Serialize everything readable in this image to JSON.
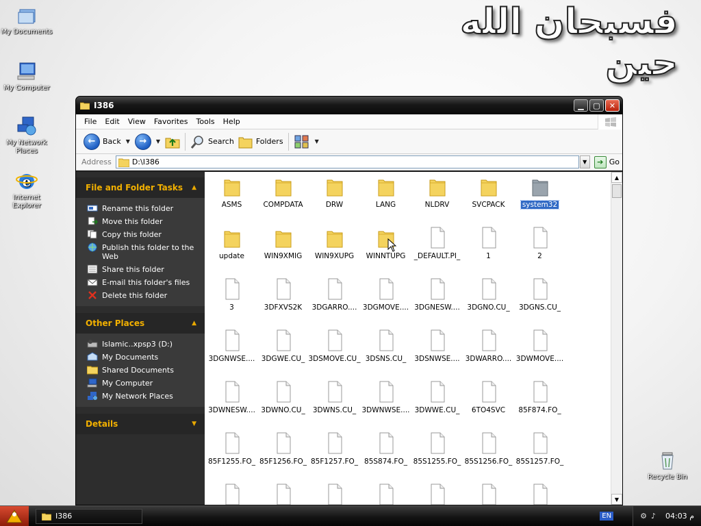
{
  "desktop": {
    "banner_text": "فسبحان الله حين",
    "icons": [
      {
        "label": "My Documents"
      },
      {
        "label": "My Computer"
      },
      {
        "label": "My Network Places"
      },
      {
        "label": "Internet Explorer"
      },
      {
        "label": "Recycle Bin"
      }
    ]
  },
  "window": {
    "title": "I386",
    "menu": [
      "File",
      "Edit",
      "View",
      "Favorites",
      "Tools",
      "Help"
    ],
    "toolbar": {
      "back": "Back",
      "search": "Search",
      "folders": "Folders"
    },
    "address": {
      "label": "Address",
      "value": "D:\\I386",
      "go": "Go"
    }
  },
  "taskpane": {
    "file_folder_tasks": {
      "title": "File and Folder Tasks",
      "items": [
        "Rename this folder",
        "Move this folder",
        "Copy this folder",
        "Publish this folder to the Web",
        "Share this folder",
        "E-mail this folder's files",
        "Delete this folder"
      ]
    },
    "other_places": {
      "title": "Other Places",
      "items": [
        "Islamic..xpsp3 (D:)",
        "My Documents",
        "Shared Documents",
        "My Computer",
        "My Network Places"
      ]
    },
    "details": {
      "title": "Details"
    }
  },
  "files": [
    {
      "name": "ASMS",
      "type": "folder"
    },
    {
      "name": "COMPDATA",
      "type": "folder"
    },
    {
      "name": "DRW",
      "type": "folder"
    },
    {
      "name": "LANG",
      "type": "folder"
    },
    {
      "name": "NLDRV",
      "type": "folder"
    },
    {
      "name": "SVCPACK",
      "type": "folder"
    },
    {
      "name": "system32",
      "type": "folder-gray",
      "selected": true
    },
    {
      "name": "update",
      "type": "folder"
    },
    {
      "name": "WIN9XMIG",
      "type": "folder"
    },
    {
      "name": "WIN9XUPG",
      "type": "folder"
    },
    {
      "name": "WINNTUPG",
      "type": "folder"
    },
    {
      "name": "_DEFAULT.PI_",
      "type": "file"
    },
    {
      "name": "1",
      "type": "file"
    },
    {
      "name": "2",
      "type": "file"
    },
    {
      "name": "3",
      "type": "file"
    },
    {
      "name": "3DFXVS2K",
      "type": "file"
    },
    {
      "name": "3DGARRO....",
      "type": "file"
    },
    {
      "name": "3DGMOVE....",
      "type": "file"
    },
    {
      "name": "3DGNESW....",
      "type": "file"
    },
    {
      "name": "3DGNO.CU_",
      "type": "file"
    },
    {
      "name": "3DGNS.CU_",
      "type": "file"
    },
    {
      "name": "3DGNWSE....",
      "type": "file"
    },
    {
      "name": "3DGWE.CU_",
      "type": "file"
    },
    {
      "name": "3DSMOVE.CU_",
      "type": "file"
    },
    {
      "name": "3DSNS.CU_",
      "type": "file"
    },
    {
      "name": "3DSNWSE....",
      "type": "file"
    },
    {
      "name": "3DWARRO....",
      "type": "file"
    },
    {
      "name": "3DWMOVE....",
      "type": "file"
    },
    {
      "name": "3DWNESW....",
      "type": "file"
    },
    {
      "name": "3DWNO.CU_",
      "type": "file"
    },
    {
      "name": "3DWNS.CU_",
      "type": "file"
    },
    {
      "name": "3DWNWSE....",
      "type": "file"
    },
    {
      "name": "3DWWE.CU_",
      "type": "file"
    },
    {
      "name": "6TO4SVC",
      "type": "file"
    },
    {
      "name": "85F874.FO_",
      "type": "file"
    },
    {
      "name": "85F1255.FO_",
      "type": "file"
    },
    {
      "name": "85F1256.FO_",
      "type": "file"
    },
    {
      "name": "85F1257.FO_",
      "type": "file"
    },
    {
      "name": "85S874.FO_",
      "type": "file"
    },
    {
      "name": "85S1255.FO_",
      "type": "file"
    },
    {
      "name": "85S1256.FO_",
      "type": "file"
    },
    {
      "name": "85S1257.FO_",
      "type": "file"
    },
    {
      "name": "",
      "type": "file"
    },
    {
      "name": "",
      "type": "file"
    },
    {
      "name": "",
      "type": "file"
    },
    {
      "name": "",
      "type": "file"
    },
    {
      "name": "",
      "type": "file"
    },
    {
      "name": "",
      "type": "file"
    },
    {
      "name": "",
      "type": "file"
    }
  ],
  "taskbar": {
    "task_label": "I386",
    "lang": "EN",
    "time": "04:03 م"
  },
  "colors": {
    "accent_orange": "#f2b000",
    "selection_blue": "#316ac5",
    "folder_yellow": "#f4d35e"
  }
}
